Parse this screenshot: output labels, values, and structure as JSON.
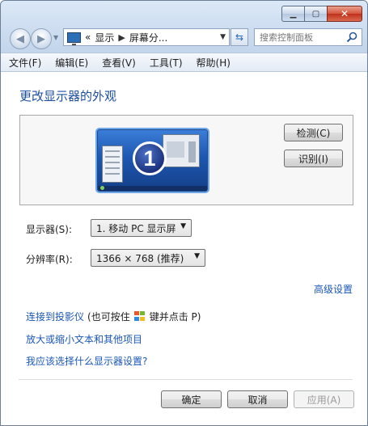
{
  "window": {
    "caption_buttons": {
      "minimize_icon": "minimize-icon",
      "maximize_icon": "maximize-icon",
      "close_icon": "close-icon"
    }
  },
  "address_bar": {
    "prefix": "«",
    "crumbs": [
      "显示",
      "屏幕分..."
    ],
    "separator": "▶"
  },
  "search": {
    "placeholder": "搜索控制面板"
  },
  "menu": [
    "文件(F)",
    "编辑(E)",
    "查看(V)",
    "工具(T)",
    "帮助(H)"
  ],
  "page": {
    "title": "更改显示器的外观",
    "monitor_number": "1",
    "detect_button": "检测(C)",
    "identify_button": "识别(I)",
    "display_label": "显示器(S):",
    "display_value": "1. 移动 PC 显示屏",
    "resolution_label": "分辨率(R):",
    "resolution_value": "1366 × 768 (推荐)",
    "advanced_link": "高级设置",
    "projector_link": "连接到投影仪",
    "projector_hint_before": "(也可按住",
    "projector_hint_after": "键并点击 P)",
    "resize_link": "放大或缩小文本和其他项目",
    "choose_link": "我应该选择什么显示器设置?"
  },
  "footer": {
    "ok": "确定",
    "cancel": "取消",
    "apply": "应用(A)"
  }
}
